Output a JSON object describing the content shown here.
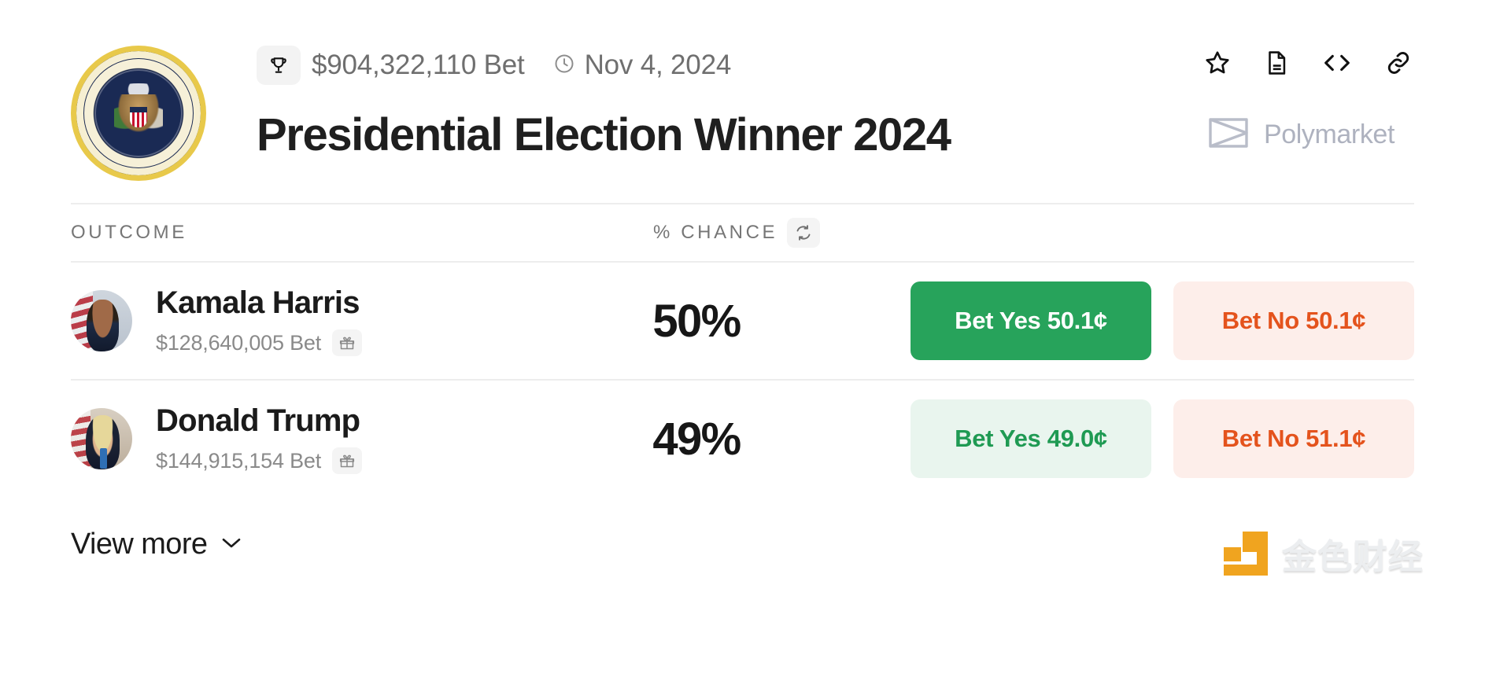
{
  "header": {
    "logo_icon": "presidential-seal",
    "trophy_icon": "trophy-icon",
    "volume": "$904,322,110 Bet",
    "clock_icon": "clock-icon",
    "date": "Nov 4, 2024",
    "title": "Presidential Election Winner 2024",
    "brand": "Polymarket",
    "brand_logo_icon": "polymarket-logo-icon",
    "actions": [
      {
        "icon": "star-icon",
        "name": "favorite-button"
      },
      {
        "icon": "document-icon",
        "name": "rules-button"
      },
      {
        "icon": "code-icon",
        "name": "embed-button"
      },
      {
        "icon": "link-icon",
        "name": "copy-link-button"
      }
    ]
  },
  "table": {
    "columns": {
      "outcome": "OUTCOME",
      "chance": "% CHANCE",
      "refresh_icon": "refresh-icon"
    },
    "rows": [
      {
        "name": "Kamala Harris",
        "volume": "$128,640,005 Bet",
        "gift_icon": "gift-icon",
        "chance": "50%",
        "yes_label": "Bet Yes 50.1¢",
        "no_label": "Bet No 50.1¢",
        "yes_style": "solid"
      },
      {
        "name": "Donald Trump",
        "volume": "$144,915,154 Bet",
        "gift_icon": "gift-icon",
        "chance": "49%",
        "yes_label": "Bet Yes 49.0¢",
        "no_label": "Bet No 51.1¢",
        "yes_style": "soft"
      }
    ]
  },
  "footer": {
    "view_more": "View more",
    "chevron_icon": "chevron-down-icon",
    "watermark": "金色财经"
  },
  "colors": {
    "yes_green": "#27a35b",
    "yes_green_soft_bg": "#e9f5ee",
    "yes_green_soft_text": "#1f9a53",
    "no_red_text": "#e4531d",
    "no_red_soft_bg": "#fdeeea",
    "brand_gray": "#aeb2bf",
    "watermark_orange": "#f0a014"
  }
}
